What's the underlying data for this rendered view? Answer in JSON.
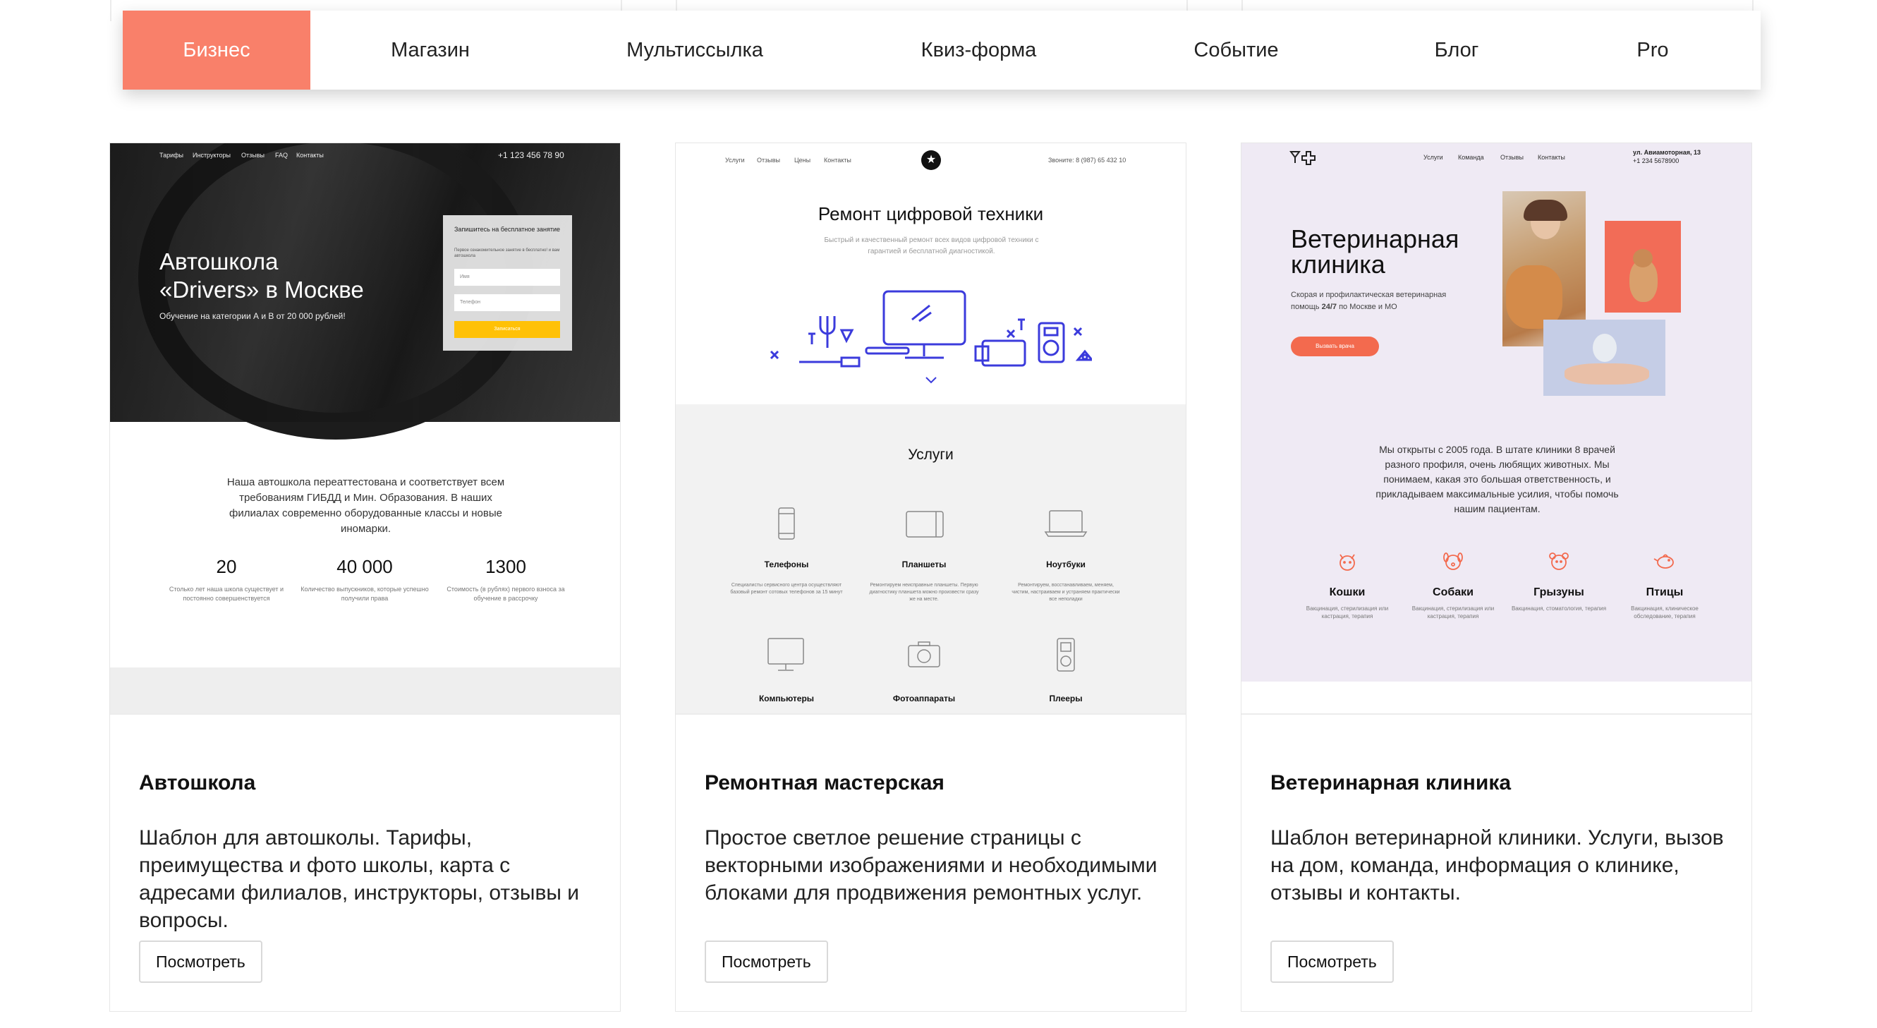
{
  "tabs": [
    {
      "label": "Бизнес",
      "active": true
    },
    {
      "label": "Магазин",
      "active": false
    },
    {
      "label": "Мультиссылка",
      "active": false
    },
    {
      "label": "Квиз-форма",
      "active": false
    },
    {
      "label": "Событие",
      "active": false
    },
    {
      "label": "Блог",
      "active": false
    },
    {
      "label": "Pro",
      "active": false
    }
  ],
  "colors": {
    "accent": "#f9806a",
    "vet_accent": "#f36a4e",
    "yellow": "#ffc107"
  },
  "cards": [
    {
      "title": "Автошкола",
      "description": "Шаблон для автошколы. Тарифы, преимущества и фото школы, карта с адресами филиалов, инструкторы, отзывы и вопросы.",
      "button": "Посмотреть",
      "preview": {
        "nav": [
          "Тарифы",
          "Инструкторы",
          "Отзывы",
          "FAQ",
          "Контакты"
        ],
        "phone": "+1 123 456 78 90",
        "heading_line1": "Автошкола",
        "heading_line2": "«Drivers» в Москве",
        "subheading": "Обучение на категории А и В от 20 000 рублей!",
        "form_title": "Запишитесь на бесплатное занятие",
        "form_subtitle": "Первое ознакомительное занятие в бесплатно! и вам автошкола",
        "form_name": "Имя",
        "form_phone": "Телефон",
        "form_button": "Записаться",
        "about": "Наша автошкола переаттестована и соответствует всем требованиям ГИБДД и Мин. Образования. В наших филиалах современно оборудованные классы и новые иномарки.",
        "stats": [
          {
            "value": "20",
            "label": "Столько лет наша школа существует и постоянно совершенствуется"
          },
          {
            "value": "40 000",
            "label": "Количество выпускников, которые успешно получили права"
          },
          {
            "value": "1300",
            "label": "Стоимость (в рублях) первого взноса за обучение в рассрочку"
          }
        ]
      }
    },
    {
      "title": "Ремонтная мастерская",
      "description": "Простое светлое решение страницы с векторными изображениями и необходимыми блоками для продвижения ремонтных услуг.",
      "button": "Посмотреть",
      "preview": {
        "nav": [
          "Услуги",
          "Отзывы",
          "Цены",
          "Контакты"
        ],
        "phone": "Звоните: 8 (987) 65 432 10",
        "logo_icon": "star-icon",
        "heading": "Ремонт цифровой техники",
        "subheading": "Быстрый и качественный ремонт всех видов цифровой техники с гарантией и бесплатной диагностикой.",
        "services_title": "Услуги",
        "services": [
          {
            "label": "Телефоны",
            "desc": "Специалисты сервисного центра осуществляют базовый ремонт сотовых телефонов за 15 минут",
            "icon": "phone-icon"
          },
          {
            "label": "Планшеты",
            "desc": "Ремонтируем неисправные планшеты. Первую диагностику планшета можно произвести сразу же на месте.",
            "icon": "tablet-icon"
          },
          {
            "label": "Ноутбуки",
            "desc": "Ремонтируем, восстанавливаем, меняем, чистим, настраиваем и устраняем практически все неполадки",
            "icon": "laptop-icon"
          },
          {
            "label": "Компьютеры",
            "desc": "",
            "icon": "monitor-icon"
          },
          {
            "label": "Фотоаппараты",
            "desc": "",
            "icon": "camera-icon"
          },
          {
            "label": "Плееры",
            "desc": "",
            "icon": "player-icon"
          }
        ]
      }
    },
    {
      "title": "Ветеринарная клиника",
      "description": "Шаблон ветеринарной клиники. Услуги, вызов на дом, команда, информация о клинике, отзывы и контакты.",
      "button": "Посмотреть",
      "preview": {
        "logo_icon": "vet-logo-icon",
        "nav": [
          "Услуги",
          "Команда",
          "Отзывы",
          "Контакты"
        ],
        "address": "ул. Авиамоторная, 13",
        "phone": "+1 234 5678900",
        "heading_line1": "Ветеринарная",
        "heading_line2": "клиника",
        "subheading_pre": "Скорая и профилактическая ветеринарная помощь ",
        "subheading_bold": "24/7",
        "subheading_post": " по Москве и МО",
        "cta": "Вызвать врача",
        "about": "Мы открыты с 2005 года. В штате клиники 8 врачей разного профиля, очень любящих животных. Мы понимаем, какая это большая ответственность, и прикладываем максимальные усилия, чтобы помочь нашим пациентам.",
        "pets": [
          {
            "label": "Кошки",
            "desc": "Вакцинация, стерилизация или кастрация, терапия",
            "icon": "cat-icon"
          },
          {
            "label": "Собаки",
            "desc": "Вакцинация, стерилизация или кастрация, терапия",
            "icon": "dog-icon"
          },
          {
            "label": "Грызуны",
            "desc": "Вакцинация, стоматология, терапия",
            "icon": "rodent-icon"
          },
          {
            "label": "Птицы",
            "desc": "Вакцинация, клиническое обследование, терапия",
            "icon": "bird-icon"
          }
        ]
      }
    }
  ]
}
